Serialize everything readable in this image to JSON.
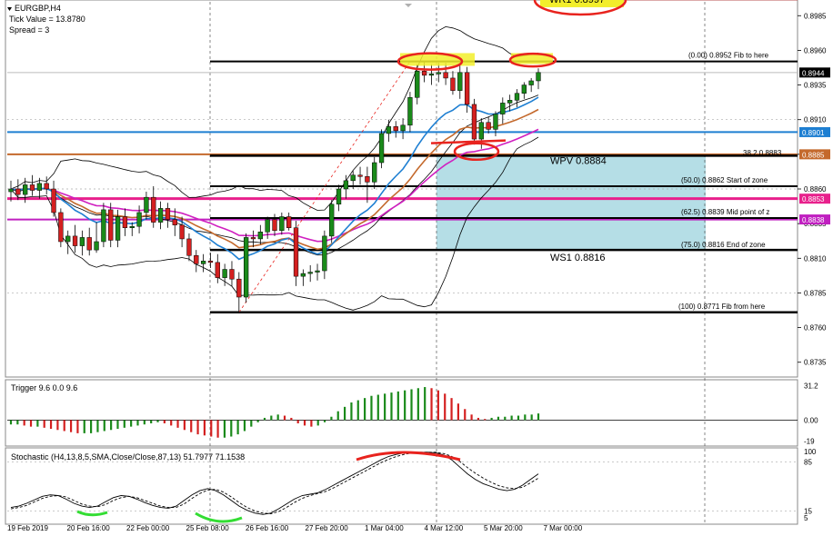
{
  "header": {
    "symbol": "EURGBP,H4",
    "tick_value": "Tick Value = 13.8780",
    "spread": "Spread = 3"
  },
  "chart_data": [
    {
      "type": "candlestick",
      "symbol": "EURGBP,H4",
      "ylim": [
        0.8725,
        0.8995
      ],
      "y_ticks": [
        "0.8985",
        "0.8960",
        "0.8935",
        "0.8910",
        "0.8885",
        "0.8860",
        "0.8835",
        "0.8810",
        "0.8785",
        "0.8760",
        "0.8735"
      ],
      "x_ticks": [
        "19 Feb 2019",
        "20 Feb 16:00",
        "22 Feb 00:00",
        "25 Feb 08:00",
        "26 Feb 16:00",
        "27 Feb 20:00",
        "1 Mar 04:00",
        "4 Mar 12:00",
        "5 Mar 20:00",
        "7 Mar 00:00"
      ],
      "candles": [
        {
          "o": 0.8858,
          "h": 0.8866,
          "l": 0.8851,
          "c": 0.886
        },
        {
          "o": 0.886,
          "h": 0.8867,
          "l": 0.8852,
          "c": 0.8856
        },
        {
          "o": 0.8856,
          "h": 0.8868,
          "l": 0.885,
          "c": 0.8863
        },
        {
          "o": 0.8863,
          "h": 0.887,
          "l": 0.8855,
          "c": 0.8859
        },
        {
          "o": 0.8859,
          "h": 0.8868,
          "l": 0.8853,
          "c": 0.8864
        },
        {
          "o": 0.8864,
          "h": 0.8869,
          "l": 0.8856,
          "c": 0.886
        },
        {
          "o": 0.886,
          "h": 0.8866,
          "l": 0.884,
          "c": 0.8843
        },
        {
          "o": 0.8843,
          "h": 0.8846,
          "l": 0.8818,
          "c": 0.8822
        },
        {
          "o": 0.8822,
          "h": 0.883,
          "l": 0.8813,
          "c": 0.8826
        },
        {
          "o": 0.8826,
          "h": 0.8834,
          "l": 0.8814,
          "c": 0.8819
        },
        {
          "o": 0.8819,
          "h": 0.883,
          "l": 0.8812,
          "c": 0.8825
        },
        {
          "o": 0.8825,
          "h": 0.8832,
          "l": 0.8812,
          "c": 0.8816
        },
        {
          "o": 0.8816,
          "h": 0.8836,
          "l": 0.8814,
          "c": 0.8822
        },
        {
          "o": 0.8822,
          "h": 0.885,
          "l": 0.8818,
          "c": 0.8845
        },
        {
          "o": 0.8845,
          "h": 0.885,
          "l": 0.8818,
          "c": 0.8823
        },
        {
          "o": 0.8823,
          "h": 0.8845,
          "l": 0.8818,
          "c": 0.884
        },
        {
          "o": 0.884,
          "h": 0.8846,
          "l": 0.8826,
          "c": 0.8832
        },
        {
          "o": 0.8832,
          "h": 0.8836,
          "l": 0.8826,
          "c": 0.8833
        },
        {
          "o": 0.8833,
          "h": 0.8848,
          "l": 0.8828,
          "c": 0.8843
        },
        {
          "o": 0.8843,
          "h": 0.8858,
          "l": 0.8838,
          "c": 0.8854
        },
        {
          "o": 0.8854,
          "h": 0.8862,
          "l": 0.8832,
          "c": 0.8836
        },
        {
          "o": 0.8836,
          "h": 0.8851,
          "l": 0.8831,
          "c": 0.8846
        },
        {
          "o": 0.8846,
          "h": 0.885,
          "l": 0.8832,
          "c": 0.8838
        },
        {
          "o": 0.8838,
          "h": 0.8846,
          "l": 0.8826,
          "c": 0.8834
        },
        {
          "o": 0.8834,
          "h": 0.884,
          "l": 0.8818,
          "c": 0.8824
        },
        {
          "o": 0.8824,
          "h": 0.8828,
          "l": 0.8808,
          "c": 0.8812
        },
        {
          "o": 0.8812,
          "h": 0.8816,
          "l": 0.88,
          "c": 0.8806
        },
        {
          "o": 0.8806,
          "h": 0.8813,
          "l": 0.88,
          "c": 0.8808
        },
        {
          "o": 0.8808,
          "h": 0.8814,
          "l": 0.8803,
          "c": 0.8807
        },
        {
          "o": 0.8807,
          "h": 0.8813,
          "l": 0.8792,
          "c": 0.8796
        },
        {
          "o": 0.8796,
          "h": 0.8806,
          "l": 0.879,
          "c": 0.8802
        },
        {
          "o": 0.8802,
          "h": 0.8808,
          "l": 0.879,
          "c": 0.8795
        },
        {
          "o": 0.8795,
          "h": 0.88,
          "l": 0.8771,
          "c": 0.8782
        },
        {
          "o": 0.8782,
          "h": 0.8828,
          "l": 0.8778,
          "c": 0.8825
        },
        {
          "o": 0.8825,
          "h": 0.883,
          "l": 0.8818,
          "c": 0.8824
        },
        {
          "o": 0.8824,
          "h": 0.8834,
          "l": 0.882,
          "c": 0.8829
        },
        {
          "o": 0.8829,
          "h": 0.884,
          "l": 0.8824,
          "c": 0.8838
        },
        {
          "o": 0.8838,
          "h": 0.8842,
          "l": 0.8826,
          "c": 0.883
        },
        {
          "o": 0.883,
          "h": 0.8843,
          "l": 0.8827,
          "c": 0.884
        },
        {
          "o": 0.884,
          "h": 0.8843,
          "l": 0.883,
          "c": 0.8832
        },
        {
          "o": 0.8832,
          "h": 0.8837,
          "l": 0.879,
          "c": 0.8797
        },
        {
          "o": 0.8797,
          "h": 0.8802,
          "l": 0.879,
          "c": 0.8799
        },
        {
          "o": 0.8799,
          "h": 0.8805,
          "l": 0.8793,
          "c": 0.88
        },
        {
          "o": 0.88,
          "h": 0.8806,
          "l": 0.8794,
          "c": 0.8801
        },
        {
          "o": 0.8801,
          "h": 0.883,
          "l": 0.8795,
          "c": 0.8826
        },
        {
          "o": 0.8826,
          "h": 0.8852,
          "l": 0.8821,
          "c": 0.8849
        },
        {
          "o": 0.8849,
          "h": 0.8863,
          "l": 0.8844,
          "c": 0.886
        },
        {
          "o": 0.886,
          "h": 0.887,
          "l": 0.8853,
          "c": 0.8866
        },
        {
          "o": 0.8866,
          "h": 0.8873,
          "l": 0.886,
          "c": 0.887
        },
        {
          "o": 0.887,
          "h": 0.8876,
          "l": 0.8863,
          "c": 0.8869
        },
        {
          "o": 0.8869,
          "h": 0.8876,
          "l": 0.885,
          "c": 0.8865
        },
        {
          "o": 0.8865,
          "h": 0.8883,
          "l": 0.886,
          "c": 0.8879
        },
        {
          "o": 0.8879,
          "h": 0.8903,
          "l": 0.8875,
          "c": 0.89
        },
        {
          "o": 0.89,
          "h": 0.891,
          "l": 0.8894,
          "c": 0.8905
        },
        {
          "o": 0.8905,
          "h": 0.8909,
          "l": 0.8897,
          "c": 0.8902
        },
        {
          "o": 0.8902,
          "h": 0.8911,
          "l": 0.8896,
          "c": 0.8906
        },
        {
          "o": 0.8906,
          "h": 0.893,
          "l": 0.8901,
          "c": 0.8926
        },
        {
          "o": 0.8926,
          "h": 0.895,
          "l": 0.8921,
          "c": 0.8945
        },
        {
          "o": 0.8945,
          "h": 0.8952,
          "l": 0.8937,
          "c": 0.8942
        },
        {
          "o": 0.8942,
          "h": 0.895,
          "l": 0.8935,
          "c": 0.8943
        },
        {
          "o": 0.8943,
          "h": 0.8951,
          "l": 0.8937,
          "c": 0.8944
        },
        {
          "o": 0.8944,
          "h": 0.8951,
          "l": 0.8935,
          "c": 0.894
        },
        {
          "o": 0.894,
          "h": 0.8945,
          "l": 0.8928,
          "c": 0.8931
        },
        {
          "o": 0.8931,
          "h": 0.895,
          "l": 0.8925,
          "c": 0.8944
        },
        {
          "o": 0.8944,
          "h": 0.8948,
          "l": 0.8915,
          "c": 0.8921
        },
        {
          "o": 0.8921,
          "h": 0.8925,
          "l": 0.8892,
          "c": 0.8896
        },
        {
          "o": 0.8896,
          "h": 0.8911,
          "l": 0.8889,
          "c": 0.8908
        },
        {
          "o": 0.8908,
          "h": 0.8912,
          "l": 0.89,
          "c": 0.8903
        },
        {
          "o": 0.8903,
          "h": 0.8916,
          "l": 0.8898,
          "c": 0.8914
        },
        {
          "o": 0.8914,
          "h": 0.8926,
          "l": 0.8907,
          "c": 0.8922
        },
        {
          "o": 0.8922,
          "h": 0.8928,
          "l": 0.8916,
          "c": 0.8924
        },
        {
          "o": 0.8924,
          "h": 0.8932,
          "l": 0.8919,
          "c": 0.8929
        },
        {
          "o": 0.8929,
          "h": 0.8937,
          "l": 0.8925,
          "c": 0.8935
        },
        {
          "o": 0.8935,
          "h": 0.894,
          "l": 0.893,
          "c": 0.8938
        },
        {
          "o": 0.8938,
          "h": 0.8947,
          "l": 0.8932,
          "c": 0.8944
        }
      ],
      "horizontal_levels": [
        {
          "value": 0.8997,
          "label": "WR1  0.8997",
          "color": "#e8231e"
        },
        {
          "value": 0.8952,
          "label": "(0.00)   0.8952   Fib to here",
          "color": "#000000"
        },
        {
          "value": 0.8901,
          "label": "",
          "color": "#1e7fd2"
        },
        {
          "value": 0.8884,
          "label": "WPV   0.8884",
          "color": "#000000"
        },
        {
          "value": 0.8883,
          "label": "38.2     0.8883",
          "color": "#000000"
        },
        {
          "value": 0.8862,
          "label": "(50.0)   0.8862    Start of zone",
          "color": "#000000"
        },
        {
          "value": 0.8853,
          "label": "",
          "color": "#e8208c"
        },
        {
          "value": 0.8839,
          "label": "(62.5)   0.8839    Mid point of z",
          "color": "#000000"
        },
        {
          "value": 0.8816,
          "label": "WS1   0.8816",
          "color": "#000000"
        },
        {
          "value": 0.8816,
          "label": "(75.0)   0.8816    End of zone",
          "color": "#000000"
        },
        {
          "value": 0.8771,
          "label": "(100)    0.8771    Fib from here",
          "color": "#000000"
        }
      ],
      "price_tags": [
        {
          "value": 0.8944,
          "label": "0.8944",
          "bg": "#000000",
          "fg": "#ffffff"
        },
        {
          "value": 0.8901,
          "label": "0.8901",
          "bg": "#1e7fd2",
          "fg": "#ffffff"
        },
        {
          "value": 0.8885,
          "label": "0.8885",
          "bg": "#c4692c",
          "fg": "#ffffff"
        },
        {
          "value": 0.8853,
          "label": "0.8853",
          "bg": "#e8208c",
          "fg": "#ffffff"
        },
        {
          "value": 0.8838,
          "label": "0.8838",
          "bg": "#c020c0",
          "fg": "#ffffff"
        }
      ],
      "zone": {
        "from": 0.8816,
        "to": 0.8885,
        "color": "#a8d8e2"
      }
    },
    {
      "type": "histogram",
      "title": "Trigger 9.6 0.0 9.6",
      "y_ticks": [
        "31.2",
        "0.00",
        "-19"
      ],
      "ylim": [
        -22,
        35
      ],
      "values": [
        -4,
        -4,
        -5,
        -6,
        -6,
        -7,
        -8,
        -9,
        -10,
        -11,
        -12,
        -12,
        -12,
        -11,
        -10,
        -9,
        -8,
        -7,
        -6,
        -5,
        -4,
        -3,
        -2,
        -3,
        -5,
        -7,
        -9,
        -11,
        -13,
        -14,
        -15,
        -16,
        -16,
        -15,
        -13,
        -10,
        -6,
        -2,
        2,
        4,
        5,
        4,
        2,
        -3,
        -5,
        -6,
        -5,
        -2,
        3,
        8,
        12,
        16,
        18,
        20,
        22,
        23,
        24,
        25,
        26,
        27,
        28,
        29,
        30,
        29,
        27,
        24,
        20,
        15,
        10,
        5,
        2,
        1,
        2,
        3,
        3,
        4,
        4,
        5,
        5,
        6
      ]
    },
    {
      "type": "line",
      "title": "Stochastic (H4,13,8,5,SMA,Close/Close,87,13) 51.7977 71.1538",
      "y_ticks": [
        "100",
        "85",
        "15",
        "5"
      ],
      "ylim": [
        0,
        100
      ],
      "series": [
        {
          "values": [
            20,
            22,
            26,
            31,
            36,
            38,
            37,
            32,
            26,
            22,
            20,
            22,
            28,
            34,
            37,
            36,
            32,
            27,
            23,
            20,
            19,
            22,
            30,
            38,
            44,
            47,
            44,
            38,
            30,
            22,
            16,
            12,
            10,
            12,
            18,
            25,
            32,
            37,
            39,
            41,
            46,
            52,
            58,
            64,
            70,
            76,
            82,
            88,
            93,
            96,
            98,
            99,
            99,
            99,
            98,
            95,
            88,
            78,
            68,
            60,
            54,
            50,
            46,
            44,
            46,
            52,
            60,
            68
          ]
        },
        {
          "values": [
            18,
            20,
            23,
            28,
            33,
            36,
            37,
            35,
            30,
            25,
            22,
            21,
            24,
            30,
            34,
            36,
            34,
            30,
            26,
            22,
            20,
            20,
            25,
            33,
            40,
            45,
            46,
            42,
            35,
            27,
            20,
            15,
            12,
            11,
            14,
            20,
            27,
            33,
            37,
            40,
            43,
            48,
            54,
            60,
            66,
            72,
            78,
            84,
            89,
            93,
            96,
            98,
            99,
            99,
            99,
            97,
            93,
            86,
            77,
            69,
            62,
            56,
            51,
            48,
            47,
            49,
            55,
            62
          ]
        }
      ]
    }
  ]
}
